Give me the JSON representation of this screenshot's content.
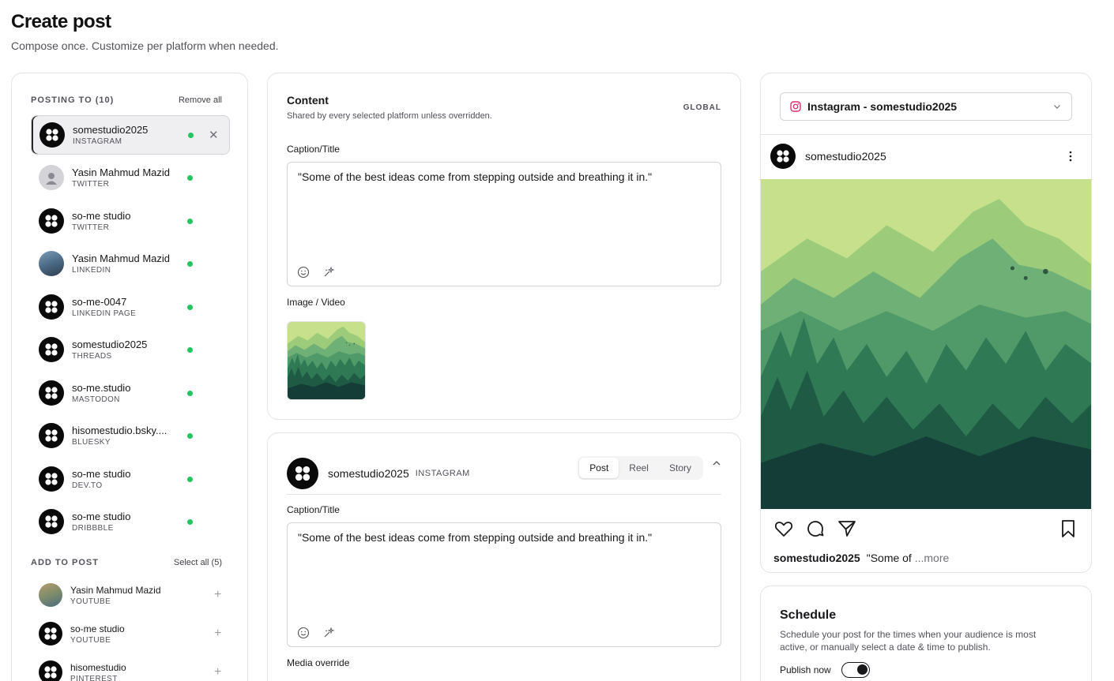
{
  "page": {
    "title": "Create post",
    "subtitle": "Compose once. Customize per platform when needed."
  },
  "posting_to": {
    "title": "POSTING TO (10)",
    "remove_all": "Remove all",
    "accounts": [
      {
        "name": "somestudio2025",
        "platform": "INSTAGRAM",
        "avatar": "logo",
        "selected": true
      },
      {
        "name": "Yasin Mahmud Mazid",
        "platform": "TWITTER",
        "avatar": "person-placeholder"
      },
      {
        "name": "so-me studio",
        "platform": "TWITTER",
        "avatar": "logo"
      },
      {
        "name": "Yasin Mahmud Mazid",
        "platform": "LINKEDIN",
        "avatar": "photo"
      },
      {
        "name": "so-me-0047",
        "platform": "LINKEDIN PAGE",
        "avatar": "logo"
      },
      {
        "name": "somestudio2025",
        "platform": "THREADS",
        "avatar": "logo"
      },
      {
        "name": "so-me.studio",
        "platform": "MASTODON",
        "avatar": "logo"
      },
      {
        "name": "hisomestudio.bsky....",
        "platform": "BLUESKY",
        "avatar": "logo"
      },
      {
        "name": "so-me studio",
        "platform": "DEV.TO",
        "avatar": "logo"
      },
      {
        "name": "so-me studio",
        "platform": "DRIBBBLE",
        "avatar": "logo"
      }
    ]
  },
  "add_to_post": {
    "title": "ADD TO POST",
    "select_all": "Select all (5)",
    "accounts": [
      {
        "name": "Yasin Mahmud Mazid",
        "platform": "YOUTUBE",
        "avatar": "photo"
      },
      {
        "name": "so-me studio",
        "platform": "YOUTUBE",
        "avatar": "logo"
      },
      {
        "name": "hisomestudio",
        "platform": "PINTEREST",
        "avatar": "logo"
      }
    ]
  },
  "content": {
    "title": "Content",
    "subtitle": "Shared by every selected platform unless overridden.",
    "tag": "GLOBAL",
    "caption_label": "Caption/Title",
    "caption": "\"Some of the best ideas come from stepping outside and breathing it in.\"",
    "media_label": "Image / Video"
  },
  "platform_override": {
    "account_name": "somestudio2025",
    "platform": "INSTAGRAM",
    "modes": [
      "Post",
      "Reel",
      "Story"
    ],
    "active_mode": "Post",
    "caption_label": "Caption/Title",
    "caption": "\"Some of the best ideas come from stepping outside and breathing it in.\"",
    "media_label": "Media override"
  },
  "preview": {
    "account_select": "Instagram - somestudio2025",
    "username": "somestudio2025",
    "caption_snippet": "\"Some of ",
    "more": "...more"
  },
  "schedule": {
    "title": "Schedule",
    "description": "Schedule your post for the times when your audience is most active, or manually select a date & time to publish.",
    "publish_now_label": "Publish now",
    "publish_now": true
  },
  "colors": {
    "status_active": "#22c55e",
    "accent": "#18181b",
    "border": "#e4e4e7"
  }
}
